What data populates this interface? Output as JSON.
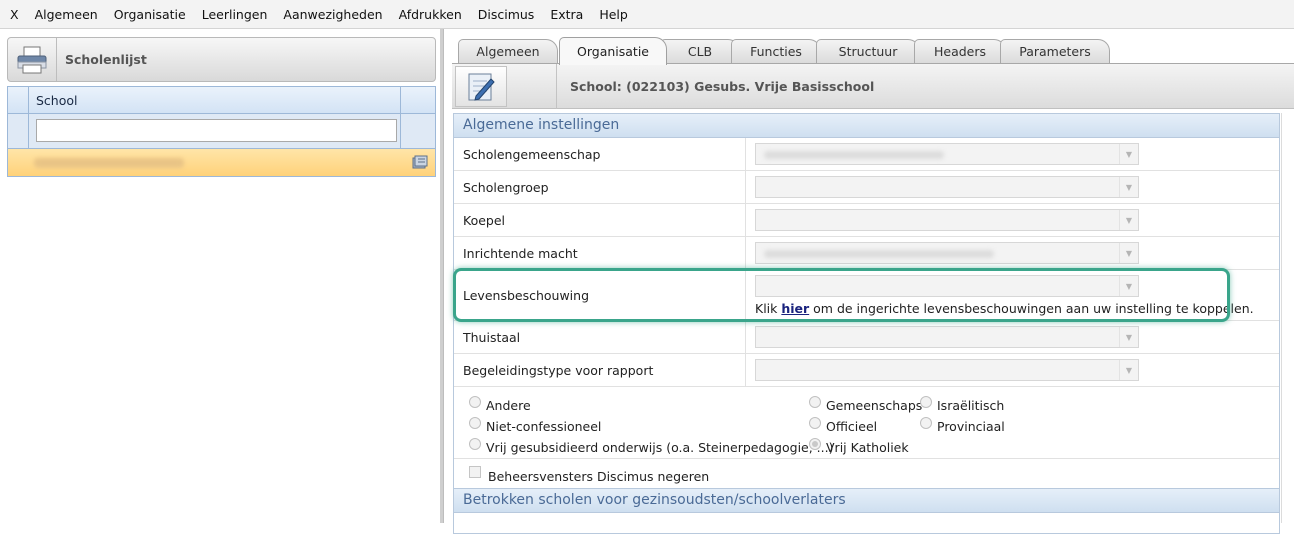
{
  "menu": [
    "X",
    "Algemeen",
    "Organisatie",
    "Leerlingen",
    "Aanwezigheden",
    "Afdrukken",
    "Discimus",
    "Extra",
    "Help"
  ],
  "left": {
    "header_title": "Scholenlijst",
    "grid_header": "School",
    "filter_value": ""
  },
  "tabs": [
    "Algemeen",
    "Organisatie",
    "CLB",
    "Functies",
    "Structuur",
    "Headers",
    "Parameters"
  ],
  "active_tab": "Organisatie",
  "school_title": "School: (022103) Gesubs. Vrije Basisschool",
  "section1": "Algemene instellingen",
  "fields": [
    {
      "label": "Scholengemeenschap"
    },
    {
      "label": "Scholengroep"
    },
    {
      "label": "Koepel"
    },
    {
      "label": "Inrichtende macht"
    },
    {
      "label": "Levensbeschouwing"
    },
    {
      "label": "Thuistaal"
    },
    {
      "label": "Begeleidingstype voor rapport"
    }
  ],
  "help": {
    "prefix": "Klik ",
    "link": "hier",
    "suffix": " om de ingerichte levensbeschouwingen aan uw instelling te koppelen."
  },
  "radios": [
    {
      "label": "Andere",
      "checked": false
    },
    {
      "label": "Niet-confessioneel",
      "checked": false
    },
    {
      "label": "Vrij gesubsidieerd onderwijs (o.a. Steinerpedagogie, ...)",
      "checked": false
    },
    {
      "label": "Gemeenschaps",
      "checked": false
    },
    {
      "label": "Officieel",
      "checked": false
    },
    {
      "label": "Vrij Katholiek",
      "checked": true
    },
    {
      "label": "Israëlitisch",
      "checked": false
    },
    {
      "label": "Provinciaal",
      "checked": false
    }
  ],
  "checkbox_label": "Beheersvensters Discimus negeren",
  "section2": "Betrokken scholen voor gezinsoudsten/schoolverlaters",
  "colors": {
    "highlight": "#3aa58b",
    "link": "#1a237e",
    "section_text": "#4a6a96"
  }
}
